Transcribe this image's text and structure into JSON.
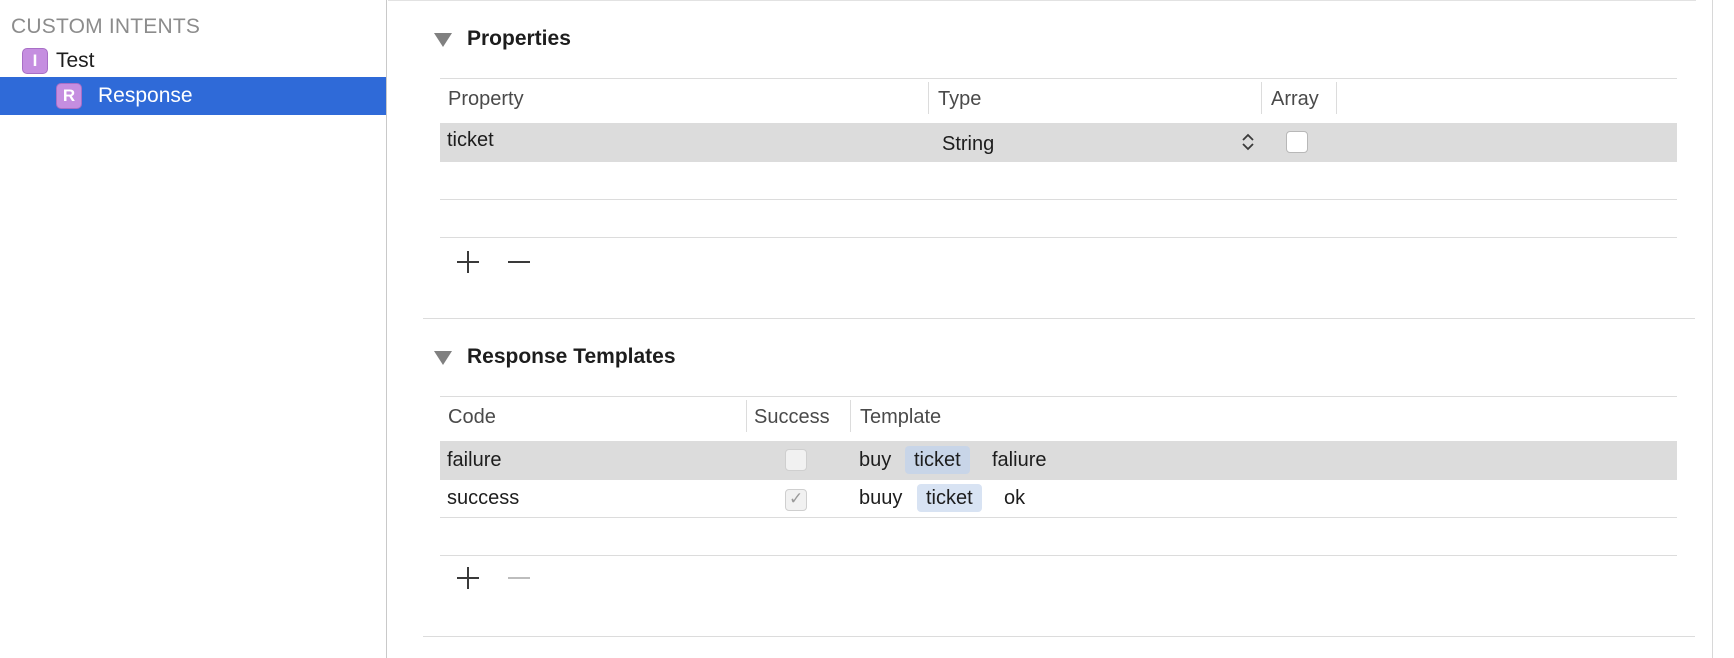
{
  "sidebar": {
    "header": "CUSTOM INTENTS",
    "items": [
      {
        "badge": "I",
        "label": "Test",
        "selected": false
      },
      {
        "badge": "R",
        "label": "Response",
        "selected": true
      }
    ]
  },
  "properties": {
    "title": "Properties",
    "columns": {
      "property": "Property",
      "type": "Type",
      "array": "Array"
    },
    "rows": [
      {
        "property": "ticket",
        "type": "String",
        "array": false
      }
    ]
  },
  "templates": {
    "title": "Response Templates",
    "columns": {
      "code": "Code",
      "success": "Success",
      "template": "Template"
    },
    "rows": [
      {
        "code": "failure",
        "success": false,
        "prefix": "buy",
        "token": "ticket",
        "suffix": "faliure"
      },
      {
        "code": "success",
        "success": true,
        "prefix": "buuy",
        "token": "ticket",
        "suffix": "ok"
      }
    ]
  },
  "icons": {
    "disclosure": "disclosure-triangle-icon",
    "add": "plus-icon",
    "remove": "minus-icon",
    "stepper": "up-down-stepper-icon",
    "check": "checkmark-icon"
  },
  "colors": {
    "selection": "#2f6ad8",
    "badge": "#c58ee0",
    "token": "#c8d5e8",
    "row_highlight": "#dcdcdc"
  }
}
